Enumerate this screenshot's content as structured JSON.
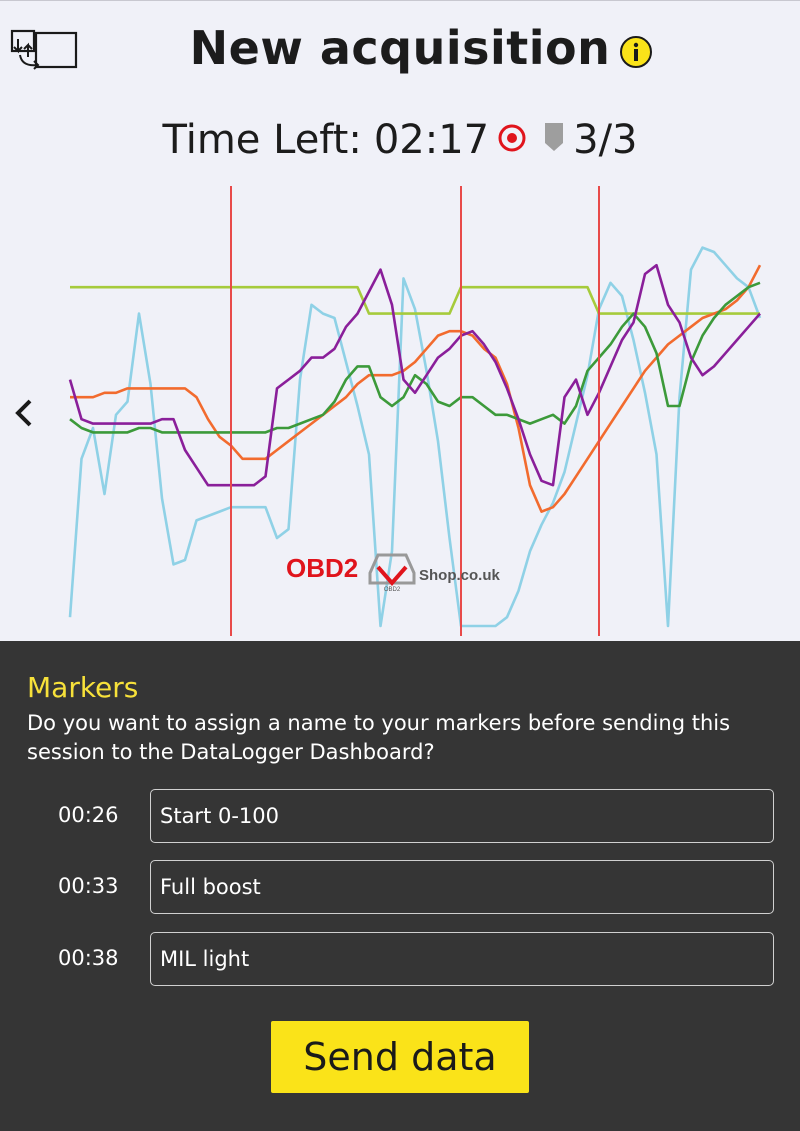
{
  "header": {
    "title": "New acquisition",
    "time_left_label": "Time Left:",
    "time_left_value": "02:17",
    "marker_count": "3/3"
  },
  "colors": {
    "accent_yellow": "#fae319",
    "marker_line": "#e84a4a",
    "record_icon": "#e0141c",
    "panel_bg": "#353535",
    "markers_heading": "#f7e13a"
  },
  "icons": {
    "fullscreen": "screen-toggle-icon",
    "info": "info-icon",
    "record": "record-target-icon",
    "marker": "marker-tag-icon",
    "previous": "chevron-left-icon"
  },
  "watermark": {
    "brand": "OBD2",
    "site": "Shop.co.uk",
    "small": "OBD2"
  },
  "chart_data": {
    "type": "line",
    "x": [
      0,
      1,
      2,
      3,
      4,
      5,
      6,
      7,
      8,
      9,
      10,
      11,
      12,
      13,
      14,
      15,
      16,
      17,
      18,
      19,
      20,
      21,
      22,
      23,
      24,
      25,
      26,
      27,
      28,
      29,
      30,
      31,
      32,
      33,
      34,
      35,
      36,
      37,
      38,
      39,
      40,
      41,
      42,
      43,
      44,
      45,
      46,
      47,
      48,
      49,
      50,
      51,
      52,
      53,
      54,
      55,
      56,
      57,
      58,
      59,
      60
    ],
    "ylim": [
      0,
      100
    ],
    "markers_x": [
      14,
      34,
      46
    ],
    "series": [
      {
        "color": "#a6cb3c",
        "values": [
          77,
          77,
          77,
          77,
          77,
          77,
          77,
          77,
          77,
          77,
          77,
          77,
          77,
          77,
          77,
          77,
          77,
          77,
          77,
          77,
          77,
          77,
          77,
          77,
          77,
          77,
          71,
          71,
          71,
          71,
          71,
          71,
          71,
          71,
          77,
          77,
          77,
          77,
          77,
          77,
          77,
          77,
          77,
          77,
          77,
          77,
          71,
          71,
          71,
          71,
          71,
          71,
          71,
          71,
          71,
          71,
          71,
          71,
          71,
          71,
          71
        ]
      },
      {
        "color": "#8a1f9a",
        "values": [
          56,
          47,
          46,
          46,
          46,
          46,
          46,
          46,
          47,
          47,
          40,
          36,
          32,
          32,
          32,
          32,
          32,
          34,
          54,
          56,
          58,
          61,
          61,
          63,
          68,
          71,
          76,
          81,
          73,
          56,
          53,
          57,
          61,
          63,
          66,
          67,
          64,
          60,
          54,
          47,
          39,
          33,
          32,
          52,
          56,
          48,
          53,
          59,
          65,
          69,
          80,
          82,
          73,
          69,
          61,
          57,
          59,
          62,
          65,
          68,
          71
        ]
      },
      {
        "color": "#3c9a3a",
        "values": [
          47,
          45,
          44,
          44,
          44,
          44,
          45,
          45,
          44,
          44,
          44,
          44,
          44,
          44,
          44,
          44,
          44,
          44,
          45,
          45,
          46,
          47,
          48,
          51,
          56,
          59,
          59,
          52,
          50,
          52,
          57,
          55,
          51,
          50,
          52,
          52,
          50,
          48,
          48,
          47,
          46,
          47,
          48,
          46,
          50,
          58,
          61,
          64,
          68,
          71,
          68,
          62,
          50,
          50,
          60,
          66,
          70,
          73,
          75,
          77,
          78
        ]
      },
      {
        "color": "#f26b2e",
        "values": [
          52,
          52,
          52,
          53,
          53,
          54,
          54,
          54,
          54,
          54,
          54,
          52,
          47,
          43,
          41,
          38,
          38,
          38,
          40,
          42,
          44,
          46,
          48,
          50,
          52,
          55,
          57,
          57,
          57,
          58,
          60,
          63,
          66,
          67,
          67,
          66,
          63,
          61,
          55,
          45,
          32,
          26,
          27,
          30,
          34,
          38,
          42,
          46,
          50,
          54,
          58,
          61,
          64,
          66,
          68,
          70,
          71,
          72,
          74,
          77,
          82
        ]
      },
      {
        "color": "#8fd1e6",
        "values": [
          2,
          38,
          45,
          30,
          48,
          51,
          71,
          55,
          29,
          14,
          15,
          24,
          25,
          26,
          27,
          27,
          27,
          27,
          20,
          22,
          56,
          73,
          71,
          70,
          60,
          50,
          39,
          0,
          17,
          79,
          72,
          58,
          42,
          20,
          0,
          0,
          0,
          0,
          2,
          8,
          17,
          23,
          28,
          35,
          46,
          57,
          72,
          78,
          75,
          65,
          53,
          39,
          0,
          52,
          81,
          86,
          85,
          82,
          79,
          77,
          70
        ]
      }
    ]
  },
  "markers_panel": {
    "heading": "Markers",
    "question": "Do you want to assign a name to your markers before sending this session to the DataLogger Dashboard?",
    "rows": [
      {
        "time": "00:26",
        "value": "Start 0-100"
      },
      {
        "time": "00:33",
        "value": "Full boost"
      },
      {
        "time": "00:38",
        "value": "MIL light"
      }
    ],
    "send_label": "Send data"
  }
}
